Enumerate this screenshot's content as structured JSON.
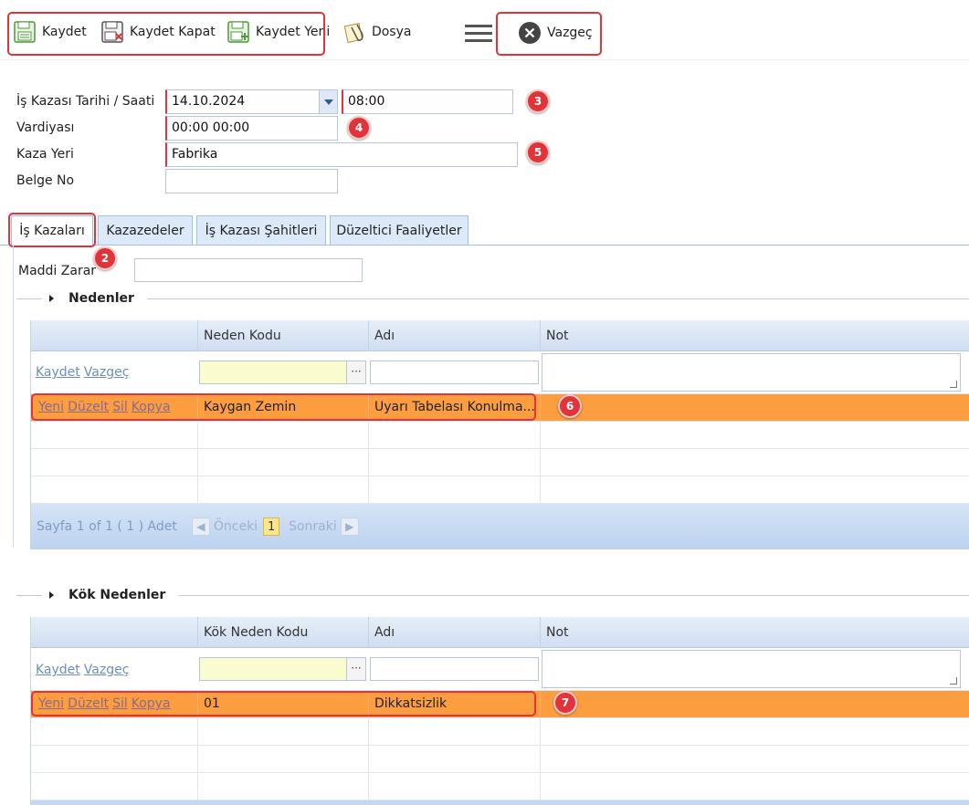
{
  "toolbar": {
    "save": "Kaydet",
    "save_close": "Kaydet Kapat",
    "save_new": "Kaydet Yeni",
    "file": "Dosya",
    "cancel": "Vazgeç"
  },
  "form": {
    "date_label": "İş Kazası Tarihi / Saati",
    "date_value": "14.10.2024",
    "time_value": "08:00",
    "shift_label": "Vardiyası",
    "shift_value": "00:00 00:00",
    "place_label": "Kaza Yeri",
    "place_value": "Fabrika",
    "doc_label": "Belge No",
    "doc_value": ""
  },
  "tabs": [
    "İş Kazaları",
    "Kazazedeler",
    "İş Kazası Şahitleri",
    "Düzeltici Faaliyetler"
  ],
  "material_damage_label": "Maddi Zarar",
  "material_damage_value": "",
  "badges": [
    "2",
    "3",
    "4",
    "5",
    "6",
    "7"
  ],
  "nedenler": {
    "title": "Nedenler",
    "columns": [
      "Neden Kodu",
      "Adı",
      "Not"
    ],
    "edit_links": [
      "Kaydet",
      "Vazgeç"
    ],
    "row_links": [
      "Yeni",
      "Düzelt",
      "Sil",
      "Kopya"
    ],
    "row": {
      "code": "Kaygan Zemin",
      "name": "Uyarı Tabelası Konulma...",
      "note": ""
    },
    "pager": {
      "text": "Sayfa 1 of 1 ( 1 ) Adet",
      "prev": "Önceki",
      "page": "1",
      "next": "Sonraki"
    }
  },
  "kok_nedenler": {
    "title": "Kök Nedenler",
    "columns": [
      "Kök Neden Kodu",
      "Adı",
      "Not"
    ],
    "edit_links": [
      "Kaydet",
      "Vazgeç"
    ],
    "row_links": [
      "Yeni",
      "Düzelt",
      "Sil",
      "Kopya"
    ],
    "row": {
      "code": "01",
      "name": "Dikkatsizlik",
      "note": ""
    }
  },
  "colors": {
    "highlight": "#e0343a",
    "selected_row": "#fc9d40",
    "grid_header": "#d7e4f4"
  }
}
